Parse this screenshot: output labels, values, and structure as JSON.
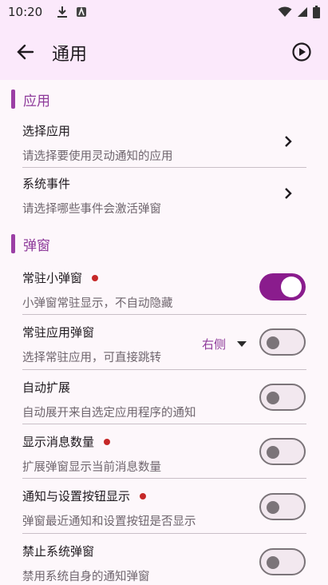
{
  "status": {
    "time": "10:20"
  },
  "appbar": {
    "title": "通用"
  },
  "sections": {
    "app": "应用",
    "popup": "弹窗"
  },
  "items": {
    "select_app": {
      "title": "选择应用",
      "subtitle": "请选择要使用灵动通知的应用"
    },
    "system_events": {
      "title": "系统事件",
      "subtitle": "请选择哪些事件会激活弹窗"
    },
    "resident_mini": {
      "title": "常驻小弹窗",
      "subtitle": "小弹窗常驻显示，不自动隐藏",
      "enabled": true
    },
    "resident_app": {
      "title": "常驻应用弹窗",
      "subtitle": "选择常驻应用，可直接跳转",
      "position": "右侧",
      "enabled": false
    },
    "auto_expand": {
      "title": "自动扩展",
      "subtitle": "自动展开来自选定应用程序的通知",
      "enabled": false
    },
    "show_count": {
      "title": "显示消息数量",
      "subtitle": "扩展弹窗显示当前消息数量",
      "enabled": false
    },
    "show_buttons": {
      "title": "通知与设置按钮显示",
      "subtitle": "弹窗最近通知和设置按钮是否显示",
      "enabled": false
    },
    "disable_system": {
      "title": "禁止系统弹窗",
      "subtitle": "禁用系统自身的通知弹窗",
      "enabled": false
    }
  },
  "colors": {
    "accent": "#8e3a9a",
    "switch_on": "#8a1c8d",
    "dot": "#c62828",
    "appbar": "#fbe9fb"
  },
  "icons": [
    "download-icon",
    "sim-icon",
    "wifi-icon",
    "signal-icon",
    "battery-icon",
    "back-arrow-icon",
    "play-icon",
    "chevron-right-icon",
    "dropdown-arrow-icon"
  ]
}
